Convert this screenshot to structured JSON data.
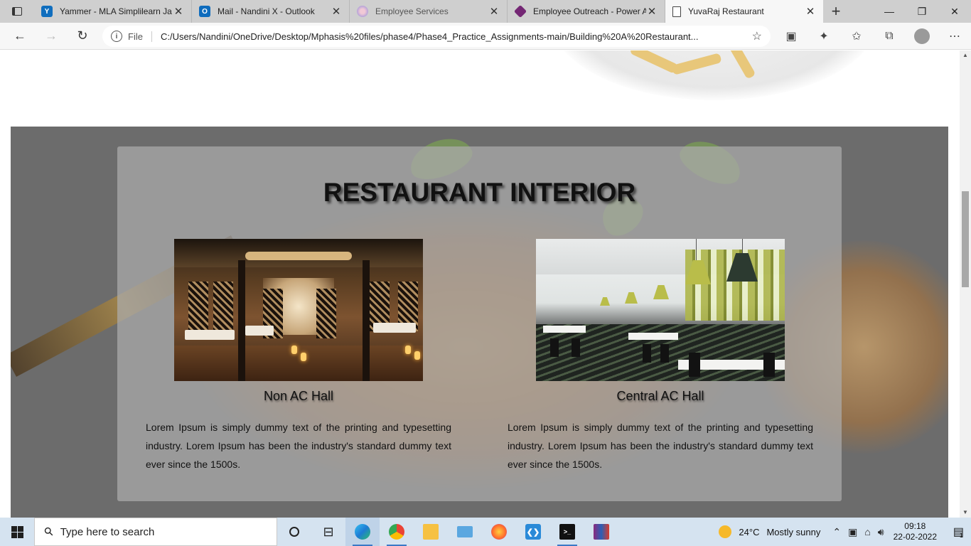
{
  "browser": {
    "tabs": [
      {
        "title": "Yammer - MLA Simplilearn Ja",
        "icon": "yammer-icon",
        "color": "#106ebe",
        "glyph": "Y",
        "active": false
      },
      {
        "title": "Mail - Nandini X - Outlook",
        "icon": "outlook-icon",
        "color": "#0f6cbd",
        "glyph": "O",
        "active": false
      },
      {
        "title": "Employee Services",
        "icon": "employee-services-icon",
        "color": "#c9a2c9",
        "glyph": "",
        "active": false
      },
      {
        "title": "Employee Outreach - Power A",
        "icon": "powerapps-icon",
        "color": "#742774",
        "glyph": "",
        "active": false
      },
      {
        "title": "YuvaRaj Restaurant",
        "icon": "page-icon",
        "color": "#ffffff",
        "glyph": "",
        "active": true
      }
    ],
    "address": {
      "scheme_label": "File",
      "url": "C:/Users/Nandini/OneDrive/Desktop/Mphasis%20files/phase4/Phase4_Practice_Assignments-main/Building%20A%20Restaurant..."
    }
  },
  "page": {
    "section_title": "RESTAURANT INTERIOR",
    "halls": [
      {
        "caption": "Non AC Hall",
        "description": "Lorem Ipsum is simply dummy text of the printing and typesetting industry. Lorem Ipsum has been the industry's standard dummy text ever since the 1500s."
      },
      {
        "caption": "Central AC Hall",
        "description": "Lorem Ipsum is simply dummy text of the printing and typesetting industry. Lorem Ipsum has been the industry's standard dummy text ever since the 1500s."
      }
    ]
  },
  "taskbar": {
    "search_placeholder": "Type here to search",
    "apps": [
      "task-view-icon",
      "widgets-icon",
      "edge-icon",
      "chrome-icon",
      "file-explorer-icon",
      "this-pc-icon",
      "firefox-icon",
      "vscode-icon",
      "terminal-icon",
      "winrar-icon"
    ],
    "weather": {
      "temp": "24°C",
      "condition": "Mostly sunny"
    },
    "clock": {
      "time": "09:18",
      "date": "22-02-2022"
    },
    "notification_count": "1"
  }
}
